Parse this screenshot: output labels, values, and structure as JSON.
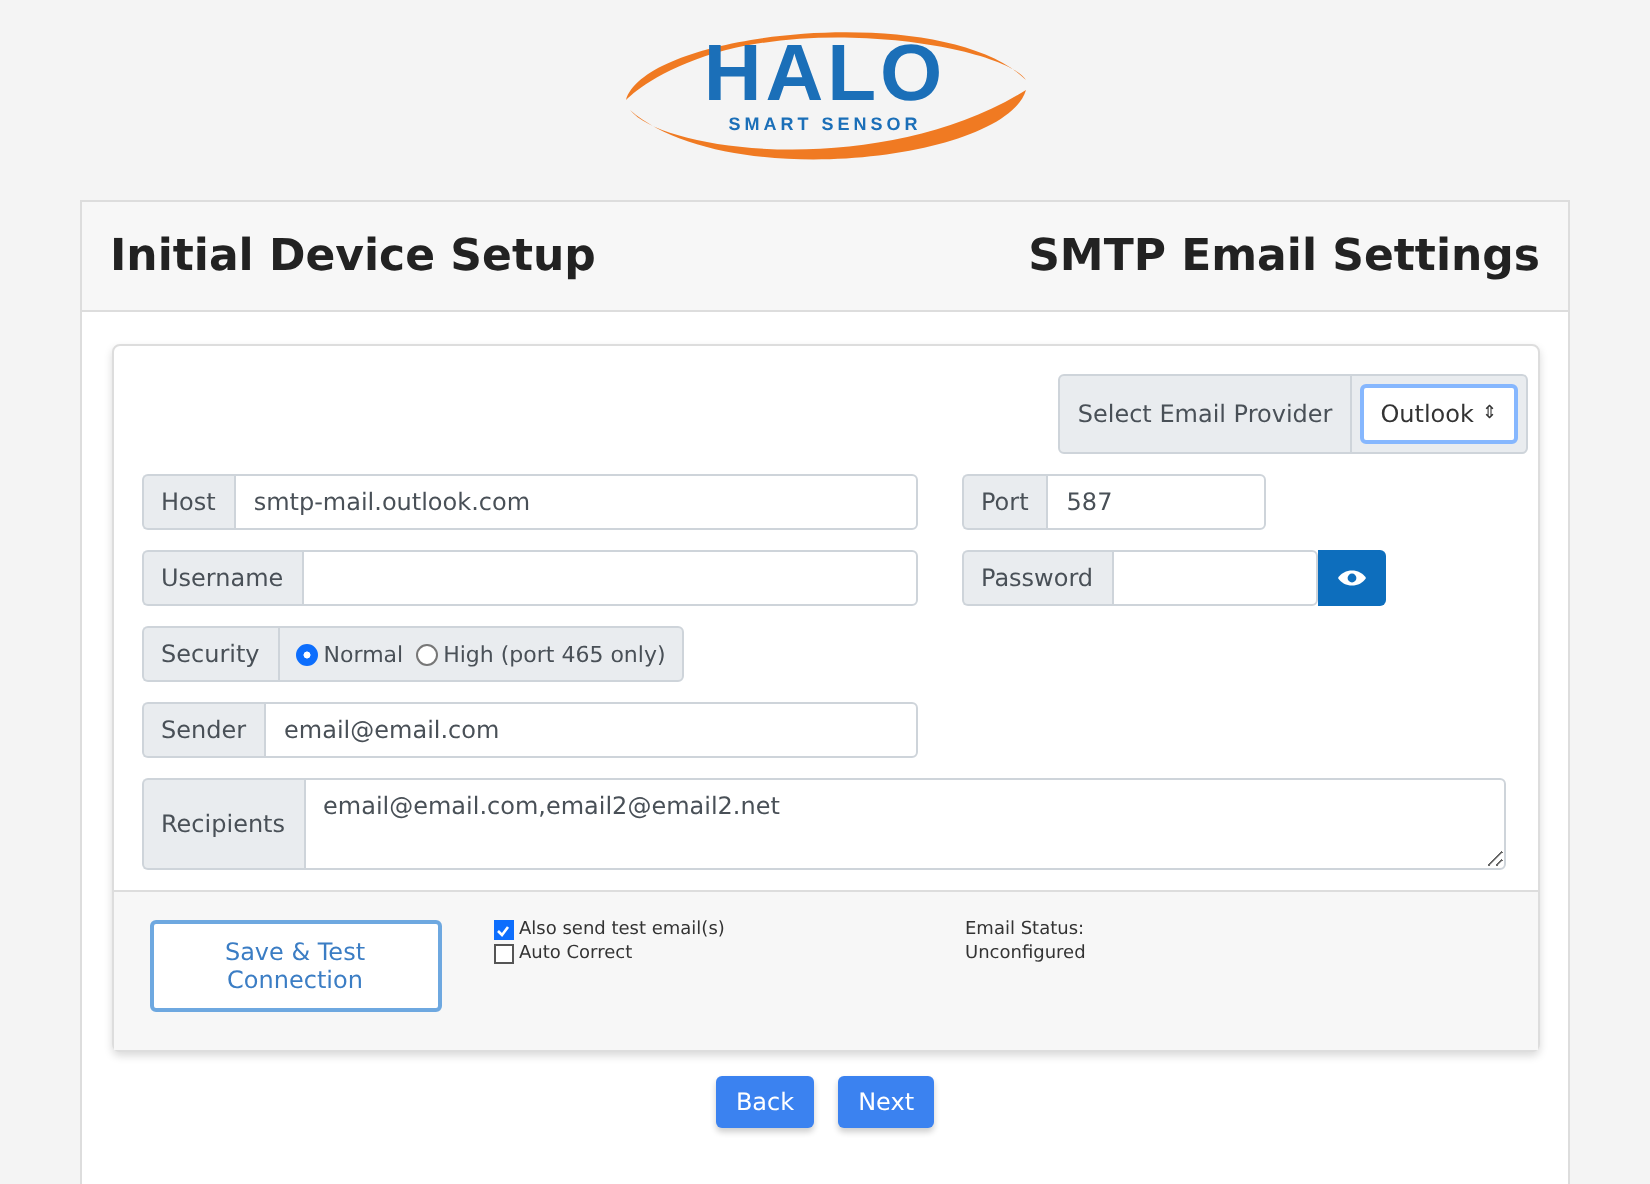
{
  "logo": {
    "name": "HALO",
    "tagline": "SMART SENSOR"
  },
  "header": {
    "title": "Initial Device Setup",
    "section": "SMTP Email Settings"
  },
  "provider": {
    "label": "Select Email Provider",
    "value": "Outlook",
    "arrows": "⇕"
  },
  "host": {
    "label": "Host",
    "value": "smtp-mail.outlook.com"
  },
  "port": {
    "label": "Port",
    "value": "587"
  },
  "username": {
    "label": "Username"
  },
  "password": {
    "label": "Password"
  },
  "security": {
    "label": "Security",
    "options": [
      {
        "label": "Normal",
        "selected": true
      },
      {
        "label": "High (port 465 only)",
        "selected": false
      }
    ]
  },
  "sender": {
    "label": "Sender",
    "value": "email@email.com"
  },
  "recipients": {
    "label": "Recipients",
    "value": "email@email.com,email2@email2.net"
  },
  "save_button": "Save & Test Connection",
  "options": [
    {
      "label": "Also send test email(s)",
      "checked": true
    },
    {
      "label": "Auto Correct",
      "checked": false
    }
  ],
  "status": {
    "label": "Email Status:",
    "value": "Unconfigured"
  },
  "nav": [
    "Back",
    "Next"
  ]
}
